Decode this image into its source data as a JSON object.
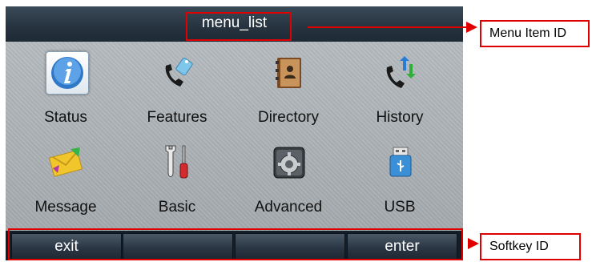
{
  "screen": {
    "title": "menu_list",
    "items": [
      {
        "label": "Status",
        "icon": "info-icon"
      },
      {
        "label": "Features",
        "icon": "phone-tag-icon"
      },
      {
        "label": "Directory",
        "icon": "address-book-icon"
      },
      {
        "label": "History",
        "icon": "call-history-icon"
      },
      {
        "label": "Message",
        "icon": "envelope-icon"
      },
      {
        "label": "Basic",
        "icon": "wrench-screwdriver-icon"
      },
      {
        "label": "Advanced",
        "icon": "gear-advanced-icon"
      },
      {
        "label": "USB",
        "icon": "usb-icon"
      }
    ],
    "selected_item": "Status",
    "softkeys": [
      "exit",
      "",
      "",
      "enter"
    ]
  },
  "annotations": {
    "menu_item_id": "Menu Item ID",
    "softkey_id": "Softkey ID"
  },
  "colors": {
    "annotation": "#e00000",
    "title_bar": "#26333f",
    "info_blue": "#2f78c8"
  }
}
